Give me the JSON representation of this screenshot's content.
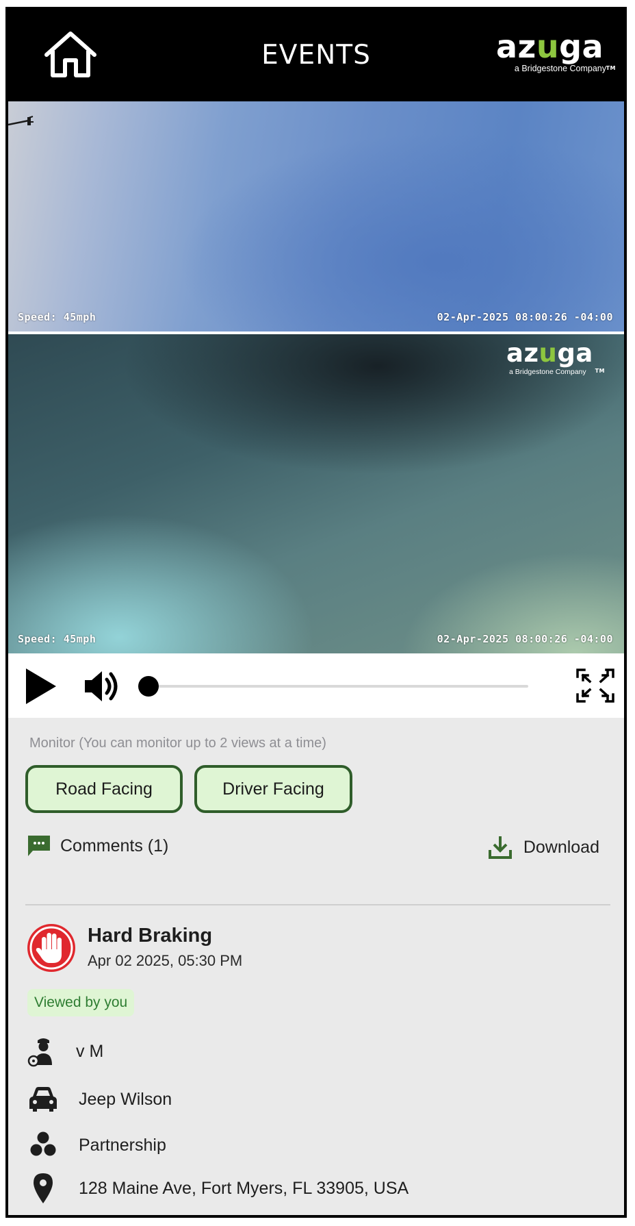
{
  "header": {
    "title": "EVENTS",
    "brand_name_prefix": "az",
    "brand_name_accent": "u",
    "brand_name_suffix": "ga",
    "brand_tagline": "a Bridgestone Company",
    "brand_tm": "TM",
    "accent_color": "#8dc63f"
  },
  "video": {
    "road_facing": {
      "speed": "Speed: 45mph",
      "timestamp": "02-Apr-2025 08:00:26 -04:00"
    },
    "driver_facing": {
      "speed": "Speed: 45mph",
      "timestamp": "02-Apr-2025 08:00:26 -04:00"
    },
    "watermark": {
      "name_prefix": "az",
      "name_accent": "u",
      "name_suffix": "ga",
      "tagline": "a Bridgestone Company",
      "tm": "TM"
    }
  },
  "player": {
    "play_icon": "play-icon",
    "volume_icon": "volume-icon",
    "fullscreen_icon": "fullscreen-icon",
    "progress": 0.0
  },
  "monitor": {
    "hint": "Monitor (You can monitor up to 2 views at a time)",
    "views": [
      "Road Facing",
      "Driver Facing"
    ]
  },
  "actions": {
    "comments_label": "Comments (1)",
    "download_label": "Download",
    "action_color": "#3a6b2f"
  },
  "event": {
    "title": "Hard Braking",
    "datetime": "Apr 02 2025, 05:30 PM",
    "status": "Viewed by you",
    "icon": "hand-stop-icon",
    "icon_color": "#e0282e"
  },
  "details": {
    "driver": "v M",
    "vehicle": "Jeep Wilson",
    "group": "Partnership",
    "location": "128 Maine Ave, Fort Myers, FL 33905, USA"
  }
}
